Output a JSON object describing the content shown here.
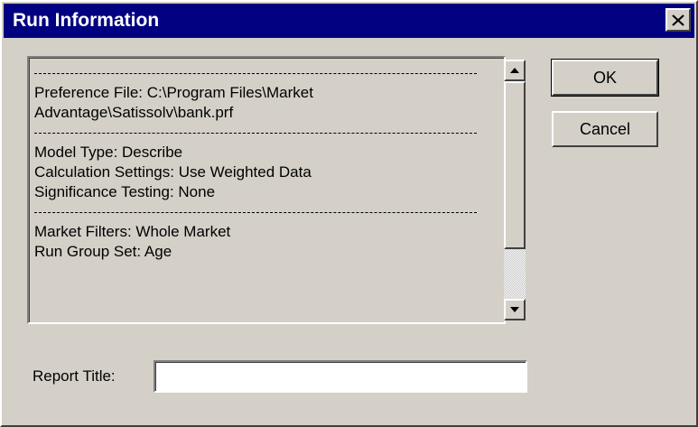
{
  "window": {
    "title": "Run Information",
    "close_icon": "close-icon"
  },
  "info_list": {
    "lines": [
      {
        "kind": "separator",
        "text": ""
      },
      {
        "kind": "text",
        "text": "Preference File: C:\\Program Files\\Market"
      },
      {
        "kind": "text",
        "text": "Advantage\\Satissolv\\bank.prf"
      },
      {
        "kind": "separator",
        "text": ""
      },
      {
        "kind": "text",
        "text": "Model Type: Describe"
      },
      {
        "kind": "text",
        "text": "Calculation Settings: Use Weighted Data"
      },
      {
        "kind": "text",
        "text": "Significance Testing: None"
      },
      {
        "kind": "separator",
        "text": ""
      },
      {
        "kind": "text",
        "text": "Market Filters: Whole Market"
      },
      {
        "kind": "text",
        "text": "Run Group Set: Age"
      }
    ],
    "scroll_up_icon": "scroll-up-arrow-icon",
    "scroll_down_icon": "scroll-down-arrow-icon"
  },
  "buttons": {
    "ok_label": "OK",
    "cancel_label": "Cancel"
  },
  "report": {
    "label": "Report Title:",
    "value": "",
    "placeholder": ""
  },
  "colors": {
    "titlebar": "#000080",
    "face": "#d4d0c8"
  }
}
